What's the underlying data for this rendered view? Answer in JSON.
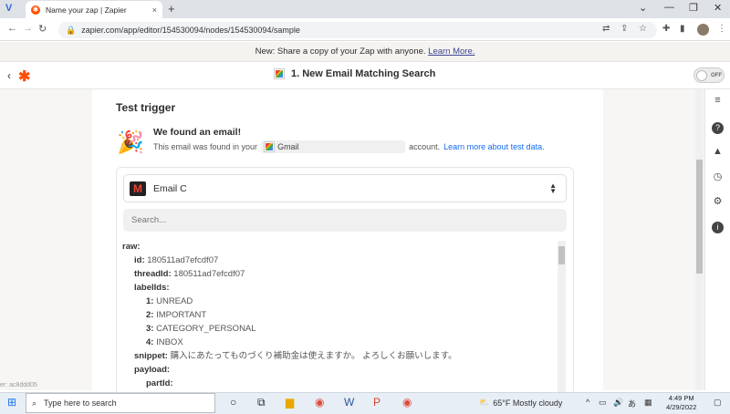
{
  "browser": {
    "tab_title": "Name your zap | Zapier",
    "tab_close": "×",
    "new_tab": "+",
    "url": "zapier.com/app/editor/154530094/nodes/154530094/sample",
    "window_controls": [
      "⌄",
      "—",
      "❐",
      "✕"
    ]
  },
  "banner": {
    "text": "New: Share a copy of your Zap with anyone.",
    "link": "Learn More."
  },
  "header": {
    "back": "‹",
    "step_title": "1. New Email Matching Search",
    "toggle_label": "OFF"
  },
  "test": {
    "title": "Test trigger",
    "found_title": "We found an email!",
    "found_prefix": "This email was found in your",
    "account": "Gmail",
    "found_suffix": "account.",
    "learn_link": "Learn more about test data."
  },
  "selector": {
    "value": "Email C"
  },
  "search": {
    "placeholder": "Search..."
  },
  "tree": [
    {
      "key": "raw:",
      "value": "",
      "level": 0
    },
    {
      "key": "id:",
      "value": "180511ad7efcdf07",
      "level": 1
    },
    {
      "key": "threadId:",
      "value": "180511ad7efcdf07",
      "level": 1
    },
    {
      "key": "labelIds:",
      "value": "",
      "level": 1
    },
    {
      "key": "1:",
      "value": "UNREAD",
      "level": 2
    },
    {
      "key": "2:",
      "value": "IMPORTANT",
      "level": 2
    },
    {
      "key": "3:",
      "value": "CATEGORY_PERSONAL",
      "level": 2
    },
    {
      "key": "4:",
      "value": "INBOX",
      "level": 2
    },
    {
      "key": "snippet:",
      "value": "購入にあたってものづくり補助金は使えますか。 よろしくお願いします。",
      "level": 1
    },
    {
      "key": "payload:",
      "value": "",
      "level": 1
    },
    {
      "key": "partId:",
      "value": "",
      "level": 2
    }
  ],
  "version_text": "er: ac8ddd05",
  "taskbar": {
    "search_placeholder": "Type here to search",
    "weather": "65°F  Mostly cloudy",
    "time": "4:49 PM",
    "date": "4/29/2022",
    "ime": "あ"
  }
}
